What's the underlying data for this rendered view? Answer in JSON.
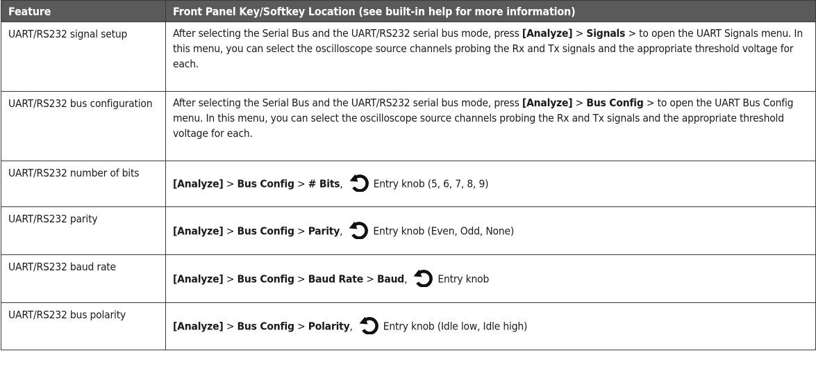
{
  "header": {
    "feature": "Feature",
    "location": "Front Panel Key/Softkey Location (see built-in help for more information)"
  },
  "rows": [
    {
      "feature": "UART/RS232 signal setup",
      "loc": {
        "pre": "After selecting the Serial Bus and the UART/RS232 serial bus mode, press ",
        "key": "[Analyze]",
        "sep": " > ",
        "softkey": "Signals",
        "post": " > to open the UART Signals menu. In this menu, you can select the oscilloscope source channels probing the Rx and Tx signals and the appropriate threshold voltage for each."
      }
    },
    {
      "feature": "UART/RS232 bus configuration",
      "loc": {
        "pre": "After selecting the Serial Bus and the UART/RS232 serial bus mode, press ",
        "key": "[Analyze]",
        "sep": " > ",
        "softkey": "Bus Config",
        "post": " > to open the UART Bus Config menu. In this menu, you can select the oscilloscope source channels probing the Rx and Tx signals and the appropriate threshold voltage for each."
      }
    },
    {
      "feature": "UART/RS232 number of bits",
      "key": "[Analyze]",
      "s1": "Bus Config",
      "s2": "# Bits",
      "s3": "",
      "knob_text": "Entry knob (5, 6, 7, 8, 9)"
    },
    {
      "feature": "UART/RS232 parity",
      "key": "[Analyze]",
      "s1": "Bus Config",
      "s2": "Parity",
      "s3": "",
      "knob_text": "Entry knob (Even, Odd, None)"
    },
    {
      "feature": "UART/RS232 baud rate",
      "key": "[Analyze]",
      "s1": "Bus Config",
      "s2": "Baud Rate",
      "s3": "Baud",
      "knob_text": "Entry knob"
    },
    {
      "feature": "UART/RS232 bus polarity",
      "key": "[Analyze]",
      "s1": "Bus Config",
      "s2": "Polarity",
      "s3": "",
      "knob_text": "Entry knob (Idle low, Idle high)"
    }
  ],
  "symbols": {
    "gt": " > ",
    "comma": ","
  },
  "icons": {
    "knob": "entry-knob-icon"
  }
}
